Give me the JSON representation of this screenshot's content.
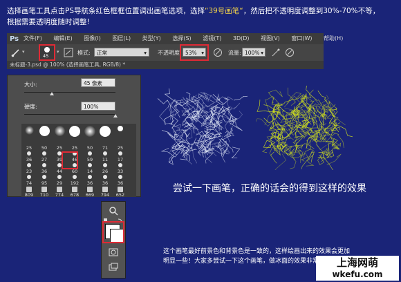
{
  "intro": {
    "line1_a": "选择画笔工具点击PS导航条红色框框位置调出画笔选项，选择",
    "line1_hl": "“39号画笔“",
    "line1_b": "，然后把不透明度调整到30%-70%不等，",
    "line2": "根据需要透明度随时调整!"
  },
  "ps": {
    "logo": "Ps",
    "menu": [
      "文件(F)",
      "编辑(E)",
      "图像(I)",
      "图层(L)",
      "类型(Y)",
      "选择(S)",
      "滤镜(T)",
      "3D(D)",
      "视图(V)",
      "窗口(W)",
      "帮助(H)"
    ],
    "brush_size_badge": "45",
    "mode_label": "模式:",
    "mode_value": "正常",
    "opacity_label": "不透明度:",
    "opacity_value": "53%",
    "flow_label": "流量:",
    "flow_value": "100%",
    "doc_tab": "未标题-3.psd @ 100% (选择画笔工具, RGB/8) *"
  },
  "brush_panel": {
    "size_label": "大小:",
    "size_value": "45 像素",
    "hardness_label": "硬度:",
    "hardness_value": "100%",
    "size_level": 0.3,
    "hardness_level": 1.0,
    "row2": [
      "25",
      "50",
      "25",
      "25",
      "50",
      "71",
      "25"
    ],
    "row3": [
      "36",
      "27",
      "39",
      "46",
      "59",
      "11",
      "17"
    ],
    "row4": [
      "23",
      "36",
      "44",
      "60",
      "14",
      "26",
      "33"
    ],
    "row5": [
      "74",
      "95",
      "29",
      "192",
      "36",
      "36",
      "36"
    ],
    "row6": [
      "809",
      "710",
      "774",
      "678",
      "669",
      "794",
      "652"
    ]
  },
  "tools": {
    "icons": [
      "zoom-icon",
      "color-swap-icon",
      "foreground-background-icon",
      "quick-mask-icon",
      "screen-mode-icon"
    ]
  },
  "demo": {
    "try_text": "尝试一下画笔，正确的话会的得到这样的效果",
    "note_line1": "这个画笔最好前景色和背景色是一致的，这样绘画出来的效果会更加",
    "note_line2": "明显一些！大家多尝试一下这个画笔，做冰面的效果非常好"
  },
  "watermark": {
    "title": "上海网萌",
    "url": "wkefu.com"
  },
  "colors": {
    "page_bg": "#1a2478",
    "highlight": "#f2d24a",
    "red_box": "#e02a35",
    "white_scribble": "#dfe6f5",
    "yellow_scribble": "#d8e81a"
  }
}
